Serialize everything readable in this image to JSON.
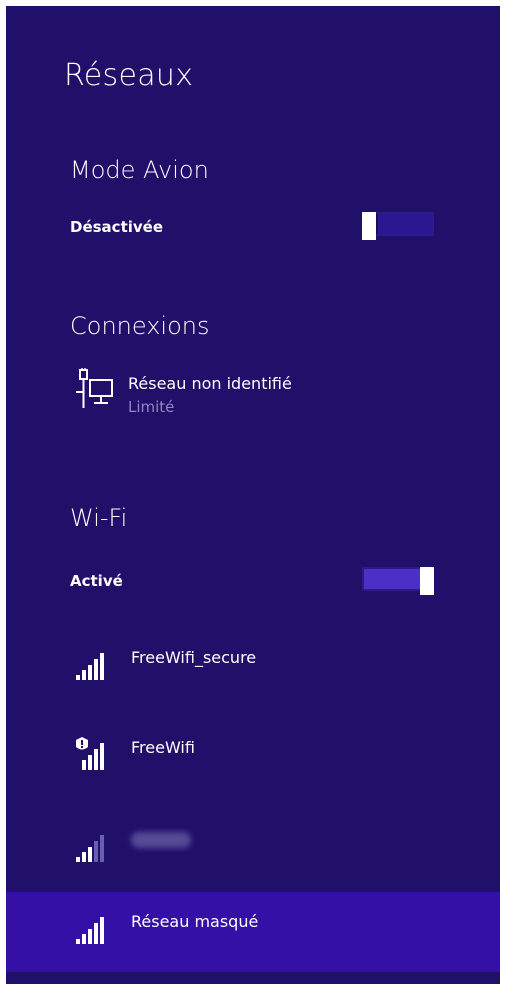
{
  "panel": {
    "title": "Réseaux"
  },
  "airplane": {
    "title": "Mode Avion",
    "status": "Désactivée",
    "toggle_on": false
  },
  "connections": {
    "title": "Connexions",
    "items": [
      {
        "name": "Réseau non identifié",
        "status": "Limité",
        "icon": "wired-network-icon"
      }
    ]
  },
  "wifi": {
    "title": "Wi-Fi",
    "status": "Activé",
    "toggle_on": true,
    "networks": [
      {
        "name": "FreeWifi_secure",
        "icon": "wifi-signal-icon",
        "selected": false
      },
      {
        "name": "FreeWifi",
        "icon": "wifi-unsecured-signal-icon",
        "selected": false
      },
      {
        "name": "",
        "icon": "wifi-weak-signal-icon",
        "selected": false,
        "blurred": true
      },
      {
        "name": "Réseau masqué",
        "icon": "wifi-signal-icon",
        "selected": true
      }
    ]
  },
  "colors": {
    "panel_bg": "#20106a",
    "selected_bg": "#3410a6",
    "muted_text": "#8f86c4"
  }
}
